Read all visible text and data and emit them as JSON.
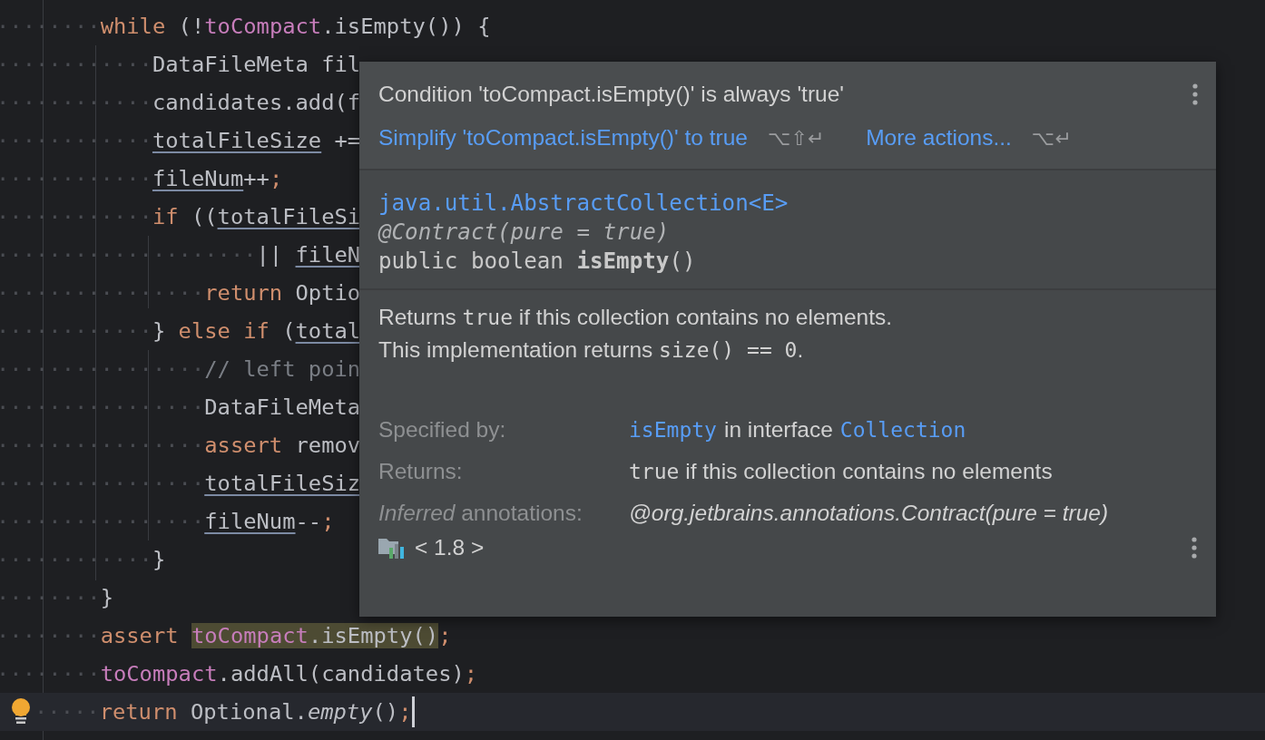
{
  "editor": {
    "lines": [
      {
        "current": false,
        "bulb": false,
        "tokens": [
          {
            "kind": "whitespace",
            "text": "········"
          },
          {
            "kind": "keyword",
            "text": "while"
          },
          {
            "kind": "plain",
            "text": " (!"
          },
          {
            "kind": "field",
            "text": "toCompact"
          },
          {
            "kind": "plain",
            "text": ".isEmpty()) {"
          }
        ]
      },
      {
        "current": false,
        "bulb": false,
        "tokens": [
          {
            "kind": "whitespace",
            "text": "············"
          },
          {
            "kind": "plain",
            "text": "DataFileMeta fil"
          }
        ]
      },
      {
        "current": false,
        "bulb": false,
        "tokens": [
          {
            "kind": "whitespace",
            "text": "············"
          },
          {
            "kind": "plain",
            "text": "candidates.add(f"
          }
        ]
      },
      {
        "current": false,
        "bulb": false,
        "tokens": [
          {
            "kind": "whitespace",
            "text": "············"
          },
          {
            "kind": "underlined",
            "text": "totalFileSize"
          },
          {
            "kind": "plain",
            "text": " +="
          }
        ]
      },
      {
        "current": false,
        "bulb": false,
        "tokens": [
          {
            "kind": "whitespace",
            "text": "············"
          },
          {
            "kind": "underlined",
            "text": "fileNum"
          },
          {
            "kind": "plain",
            "text": "++"
          },
          {
            "kind": "punct",
            "text": ";"
          }
        ]
      },
      {
        "current": false,
        "bulb": false,
        "tokens": [
          {
            "kind": "whitespace",
            "text": "············"
          },
          {
            "kind": "keyword",
            "text": "if"
          },
          {
            "kind": "plain",
            "text": " (("
          },
          {
            "kind": "underlined",
            "text": "totalFileSi"
          }
        ]
      },
      {
        "current": false,
        "bulb": false,
        "tokens": [
          {
            "kind": "whitespace",
            "text": "····················"
          },
          {
            "kind": "plain",
            "text": "|| "
          },
          {
            "kind": "underlined",
            "text": "fileN"
          }
        ]
      },
      {
        "current": false,
        "bulb": false,
        "tokens": [
          {
            "kind": "whitespace",
            "text": "················"
          },
          {
            "kind": "keyword",
            "text": "return"
          },
          {
            "kind": "plain",
            "text": " Optio"
          }
        ]
      },
      {
        "current": false,
        "bulb": false,
        "tokens": [
          {
            "kind": "whitespace",
            "text": "············"
          },
          {
            "kind": "plain",
            "text": "} "
          },
          {
            "kind": "keyword",
            "text": "else if"
          },
          {
            "kind": "plain",
            "text": " ("
          },
          {
            "kind": "underlined",
            "text": "total"
          }
        ]
      },
      {
        "current": false,
        "bulb": false,
        "tokens": [
          {
            "kind": "whitespace",
            "text": "················"
          },
          {
            "kind": "comment",
            "text": "// left poin"
          }
        ]
      },
      {
        "current": false,
        "bulb": false,
        "tokens": [
          {
            "kind": "whitespace",
            "text": "················"
          },
          {
            "kind": "plain",
            "text": "DataFileMeta"
          }
        ]
      },
      {
        "current": false,
        "bulb": false,
        "tokens": [
          {
            "kind": "whitespace",
            "text": "················"
          },
          {
            "kind": "keyword",
            "text": "assert"
          },
          {
            "kind": "plain",
            "text": " remov"
          }
        ]
      },
      {
        "current": false,
        "bulb": false,
        "tokens": [
          {
            "kind": "whitespace",
            "text": "················"
          },
          {
            "kind": "underlined",
            "text": "totalFileSiz"
          }
        ]
      },
      {
        "current": false,
        "bulb": false,
        "tokens": [
          {
            "kind": "whitespace",
            "text": "················"
          },
          {
            "kind": "underlined",
            "text": "fileNum"
          },
          {
            "kind": "plain",
            "text": "--"
          },
          {
            "kind": "punct",
            "text": ";"
          }
        ]
      },
      {
        "current": false,
        "bulb": false,
        "tokens": [
          {
            "kind": "whitespace",
            "text": "············"
          },
          {
            "kind": "plain",
            "text": "}"
          }
        ]
      },
      {
        "current": false,
        "bulb": false,
        "tokens": [
          {
            "kind": "whitespace",
            "text": "········"
          },
          {
            "kind": "plain",
            "text": "}"
          }
        ]
      },
      {
        "current": false,
        "bulb": false,
        "tokens": [
          {
            "kind": "whitespace",
            "text": "········"
          },
          {
            "kind": "keyword",
            "text": "assert "
          },
          {
            "kind": "highlight",
            "tokens": [
              {
                "kind": "field",
                "text": "toCompact"
              },
              {
                "kind": "plain",
                "text": ".isEmpty()"
              }
            ]
          },
          {
            "kind": "punct",
            "text": ";"
          }
        ]
      },
      {
        "current": false,
        "bulb": false,
        "tokens": [
          {
            "kind": "whitespace",
            "text": "········"
          },
          {
            "kind": "field",
            "text": "toCompact"
          },
          {
            "kind": "plain",
            "text": ".addAll(candidates)"
          },
          {
            "kind": "punct",
            "text": ";"
          }
        ]
      },
      {
        "current": true,
        "bulb": true,
        "tokens": [
          {
            "kind": "whitespace",
            "text": "·····"
          },
          {
            "kind": "keyword",
            "text": "return"
          },
          {
            "kind": "plain",
            "text": " Optional."
          },
          {
            "kind": "italic",
            "text": "empty"
          },
          {
            "kind": "plain",
            "text": "()"
          },
          {
            "kind": "punct",
            "text": ";"
          }
        ]
      }
    ]
  },
  "popup": {
    "problem": "Condition 'toCompact.isEmpty()' is always 'true'",
    "actions": [
      {
        "label": "Simplify 'toCompact.isEmpty()' to true",
        "shortcut": "⌥⇧↵"
      },
      {
        "label": "More actions...",
        "shortcut": "⌥↵"
      }
    ],
    "signature": {
      "class": "java.util.AbstractCollection<E>",
      "annotation": "@Contract(pure = true)",
      "declaration": "public boolean **isEmpty**()"
    },
    "description": [
      [
        {
          "kind": "text",
          "text": "Returns "
        },
        {
          "kind": "code",
          "text": "true"
        },
        {
          "kind": "text",
          "text": " if this collection contains no elements."
        }
      ],
      [
        {
          "kind": "text",
          "text": "This implementation returns "
        },
        {
          "kind": "code",
          "text": "size() == 0"
        },
        {
          "kind": "text",
          "text": "."
        }
      ]
    ],
    "details": [
      {
        "label": "Specified by:",
        "value": [
          {
            "kind": "link",
            "text": "isEmpty"
          },
          {
            "kind": "text",
            "text": "in interface"
          },
          {
            "kind": "link",
            "text": "Collection"
          }
        ]
      },
      {
        "label": "Returns:",
        "value": [
          {
            "kind": "sentence",
            "parts": [
              {
                "kind": "code",
                "text": "true"
              },
              {
                "kind": "text",
                "text": " if this collection contains no elements"
              }
            ]
          }
        ]
      },
      {
        "label": "*Inferred* annotations:",
        "value": [
          {
            "kind": "annotation",
            "text": "@org.jetbrains.annotations.Contract(pure = true)"
          }
        ]
      }
    ],
    "library": "< 1.8 >"
  }
}
